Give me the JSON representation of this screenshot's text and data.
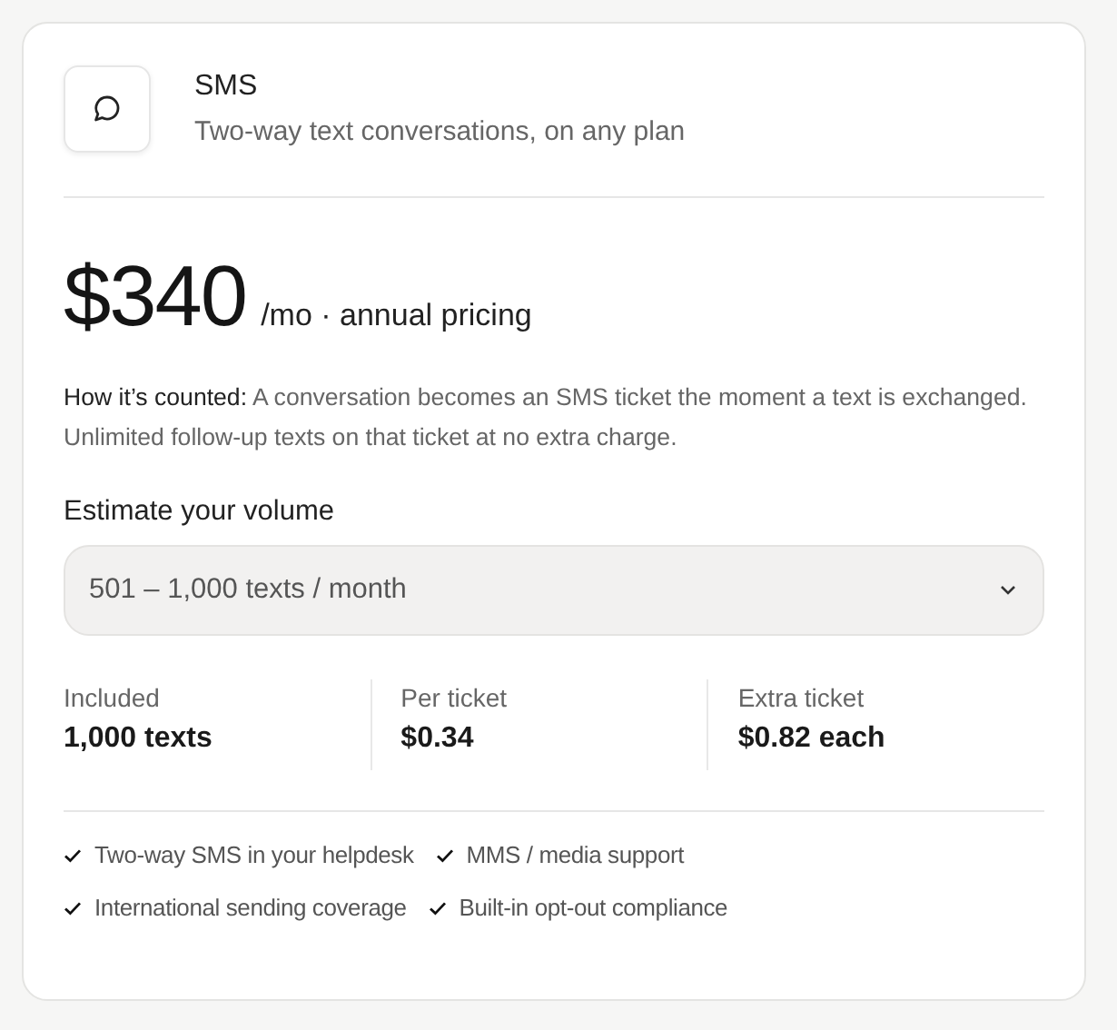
{
  "product": {
    "title": "SMS",
    "subtitle": "Two-way text conversations, on any plan"
  },
  "price": {
    "amount": "$340",
    "period": "/mo · annual pricing"
  },
  "note": "**How it’s counted:** A conversation becomes an SMS ticket the moment a text is exchanged. Unlimited follow-up texts on that ticket at no extra charge.",
  "volume": {
    "label": "Estimate your volume",
    "value": "501 – 1,000 texts / month"
  },
  "stats": [
    {
      "label": "Included",
      "value": "1,000 texts"
    },
    {
      "label": "Per ticket",
      "value": "$0.34"
    },
    {
      "label": "Extra ticket",
      "value": "$0.82 each"
    }
  ],
  "features": [
    "Two-way SMS in your helpdesk",
    "MMS / media support",
    "International sending coverage",
    "Built-in opt-out compliance"
  ]
}
